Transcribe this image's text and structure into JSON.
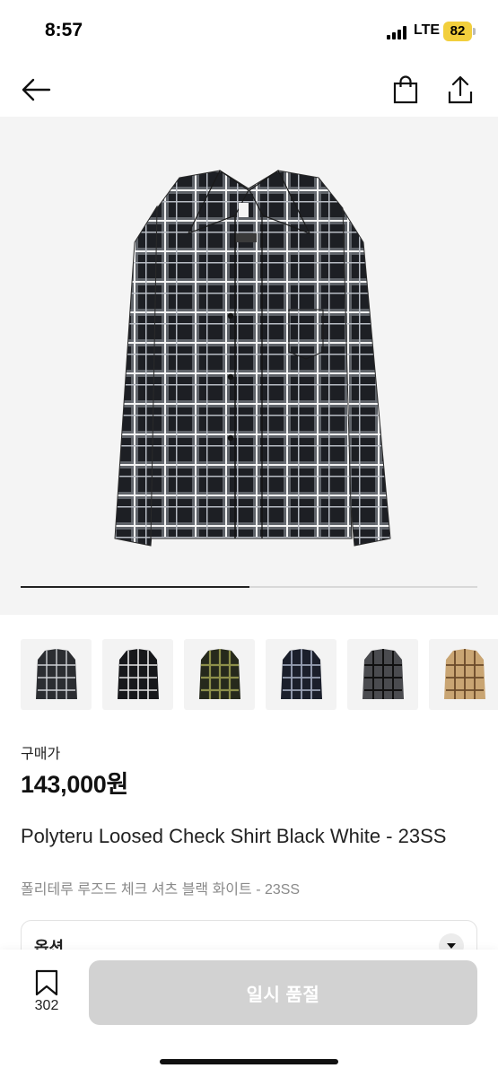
{
  "status_bar": {
    "time": "8:57",
    "network": "LTE",
    "battery": "82",
    "battery_color": "#f2cf3c"
  },
  "nav": {
    "back_icon": "arrow-left-icon",
    "cart_icon": "shopping-bag-icon",
    "share_icon": "share-icon"
  },
  "gallery": {
    "image_count": 6,
    "current_index": 1,
    "progress_fraction": 0.5,
    "thumbnails": [
      {
        "colorway": "black-white",
        "active": true
      },
      {
        "colorway": "black-white",
        "active": false
      },
      {
        "colorway": "olive-black",
        "active": false
      },
      {
        "colorway": "navy-black",
        "active": false
      },
      {
        "colorway": "grey-black",
        "active": false
      },
      {
        "colorway": "beige-brown",
        "active": false
      }
    ]
  },
  "product": {
    "price_label": "구매가",
    "price": "143,000원",
    "title": "Polyteru Loosed Check Shirt Black White - 23SS",
    "subtitle": "폴리테루 루즈드 체크 셔츠 블랙 화이트 - 23SS"
  },
  "options": {
    "label": "옵션"
  },
  "bottom_bar": {
    "wishlist_count": "302",
    "buy_button_label": "일시 품절",
    "buy_button_color": "#d2d2d2"
  }
}
